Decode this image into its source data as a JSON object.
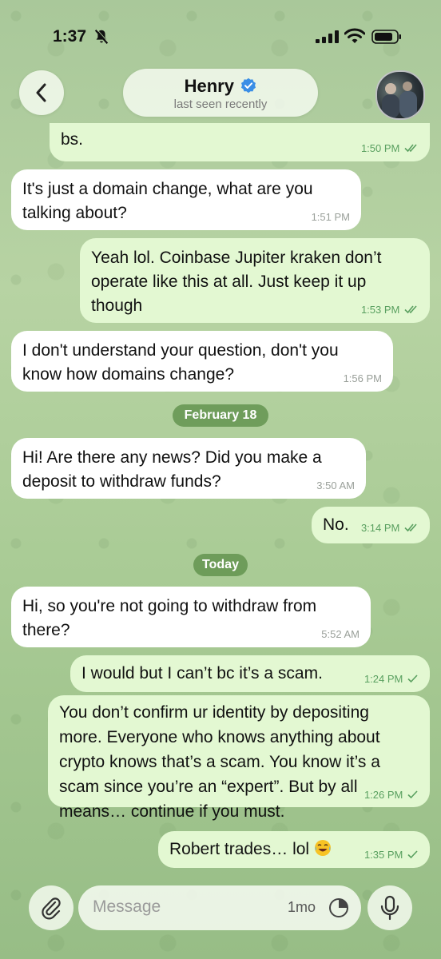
{
  "status_bar": {
    "time": "1:37"
  },
  "header": {
    "contact_name": "Henry",
    "last_seen": "last seen recently"
  },
  "messages": [
    {
      "direction": "out",
      "lines": [
        "bs."
      ],
      "time": "1:50 PM",
      "status": "read"
    },
    {
      "direction": "in",
      "lines": [
        "It's just a domain change, what are you",
        "talking about?"
      ],
      "time": "1:51 PM"
    },
    {
      "direction": "out",
      "lines": [
        "Yeah lol. Coinbase Jupiter kraken don’t",
        "operate like this at all. Just keep it up",
        "though"
      ],
      "time": "1:53 PM",
      "status": "read"
    },
    {
      "direction": "in",
      "lines": [
        "I don't understand your question, don't you",
        "know how domains change?"
      ],
      "time": "1:56 PM"
    },
    {
      "direction": "in",
      "lines": [
        "Hi! Are there any news? Did you make a",
        "deposit to withdraw funds?"
      ],
      "time": "3:50 AM"
    },
    {
      "direction": "out",
      "lines": [
        "No."
      ],
      "time": "3:14 PM",
      "status": "read"
    },
    {
      "direction": "in",
      "lines": [
        "Hi, so you're not going to withdraw from",
        "there?"
      ],
      "time": "5:52 AM"
    },
    {
      "direction": "out",
      "lines": [
        "I would but I can’t bc it’s a scam."
      ],
      "time": "1:24 PM",
      "status": "sent"
    },
    {
      "direction": "out",
      "lines": [
        "You don’t confirm ur identity by depositing",
        "more. Everyone who knows anything about",
        "crypto knows that’s a scam. You know it’s a",
        "scam since you’re an “expert”. But by all",
        "means… continue if you must."
      ],
      "time": "1:26 PM",
      "status": "sent"
    },
    {
      "direction": "out",
      "lines": [
        "Robert trades… lol"
      ],
      "emoji": "face-with-tears-of-joy",
      "time": "1:35 PM",
      "status": "sent"
    }
  ],
  "date_separators": [
    "February 18",
    "Today"
  ],
  "input_bar": {
    "placeholder": "Message",
    "timer_label": "1mo"
  },
  "colors": {
    "incoming_bubble": "#ffffff",
    "outgoing_bubble": "#e3f8d2",
    "outgoing_meta": "#5aa060",
    "date_pill": "#5a8c46"
  },
  "icons": [
    "bell-slash-icon",
    "signal-icon",
    "wifi-icon",
    "battery-icon",
    "back-chevron-icon",
    "verified-badge-icon",
    "paperclip-icon",
    "timer-icon",
    "microphone-icon"
  ]
}
